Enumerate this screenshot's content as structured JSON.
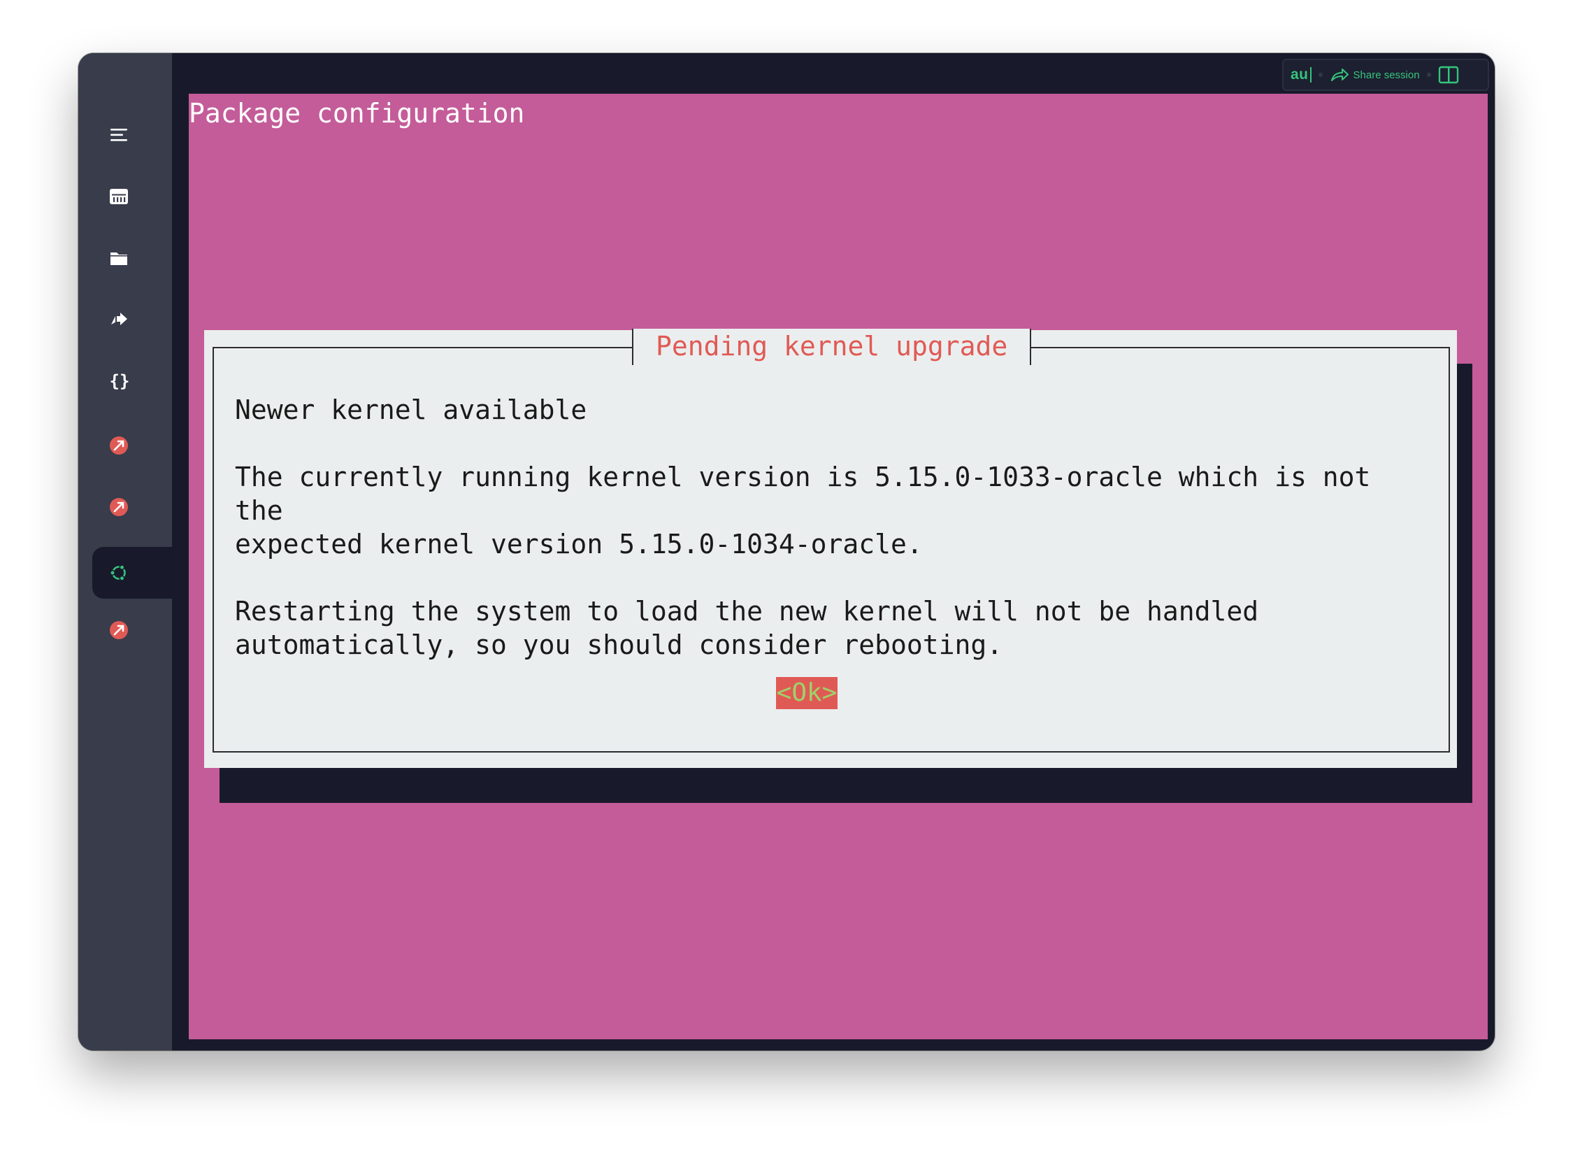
{
  "window": {
    "traffic_lights": [
      "close",
      "minimize",
      "zoom"
    ]
  },
  "topbar": {
    "app_badge": "au",
    "share_label": "Share session",
    "share_icon": "share-arrow-icon",
    "split_icon": "split-view-icon"
  },
  "sidebar": {
    "items": [
      {
        "icon": "menu-icon",
        "active": false
      },
      {
        "icon": "hosts-grid-icon",
        "active": false
      },
      {
        "icon": "folder-icon",
        "active": false
      },
      {
        "icon": "port-forward-icon",
        "active": false
      },
      {
        "icon": "snippets-braces-icon",
        "active": false
      },
      {
        "icon": "connection-red-icon",
        "active": false
      },
      {
        "icon": "connection-red-icon",
        "active": false
      },
      {
        "icon": "ubuntu-icon",
        "active": true
      },
      {
        "icon": "connection-red-icon",
        "active": false
      }
    ]
  },
  "terminal": {
    "title": "Package configuration",
    "dialog": {
      "title": "Pending kernel upgrade",
      "heading": "Newer kernel available",
      "paragraph1": "The currently running kernel version is 5.15.0-1033-oracle which is not the\nexpected kernel version 5.15.0-1034-oracle.",
      "paragraph2": "Restarting the system to load the new kernel will not be handled\nautomatically, so you should consider rebooting.",
      "ok_label": "<Ok>"
    }
  },
  "colors": {
    "terminal_background": "#c45c99",
    "dialog_background": "#ebeeee",
    "dialog_title": "#e05a55",
    "ok_button_background": "#e05a55",
    "ok_button_text": "#9ed268",
    "accent_green": "#35c47e",
    "sidebar_background": "#383c4b",
    "window_background": "#181a2b"
  }
}
